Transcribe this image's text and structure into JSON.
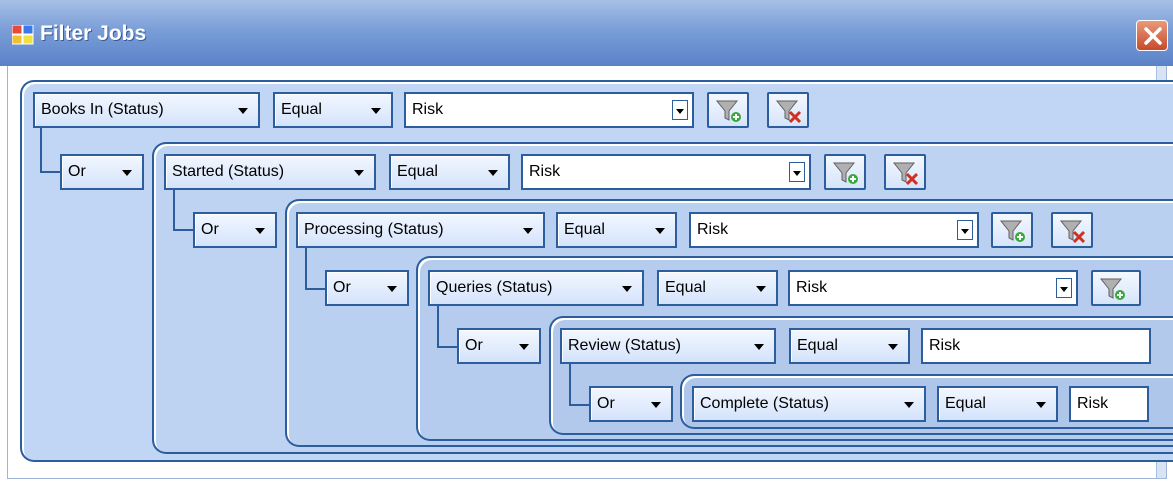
{
  "window": {
    "title": "Filter Jobs"
  },
  "rows": [
    {
      "field": "Books In (Status)",
      "op": "Equal",
      "value": "Risk"
    },
    {
      "field": "Started (Status)",
      "op": "Equal",
      "value": "Risk",
      "logic": "Or"
    },
    {
      "field": "Processing (Status)",
      "op": "Equal",
      "value": "Risk",
      "logic": "Or"
    },
    {
      "field": "Queries (Status)",
      "op": "Equal",
      "value": "Risk",
      "logic": "Or"
    },
    {
      "field": "Review (Status)",
      "op": "Equal",
      "value": "Risk",
      "logic": "Or"
    },
    {
      "field": "Complete (Status)",
      "op": "Equal",
      "value": "Risk",
      "logic": "Or"
    }
  ],
  "icons": {
    "add": "filter-add-icon",
    "remove": "filter-remove-icon",
    "close": "close-icon",
    "app": "app-icon"
  }
}
